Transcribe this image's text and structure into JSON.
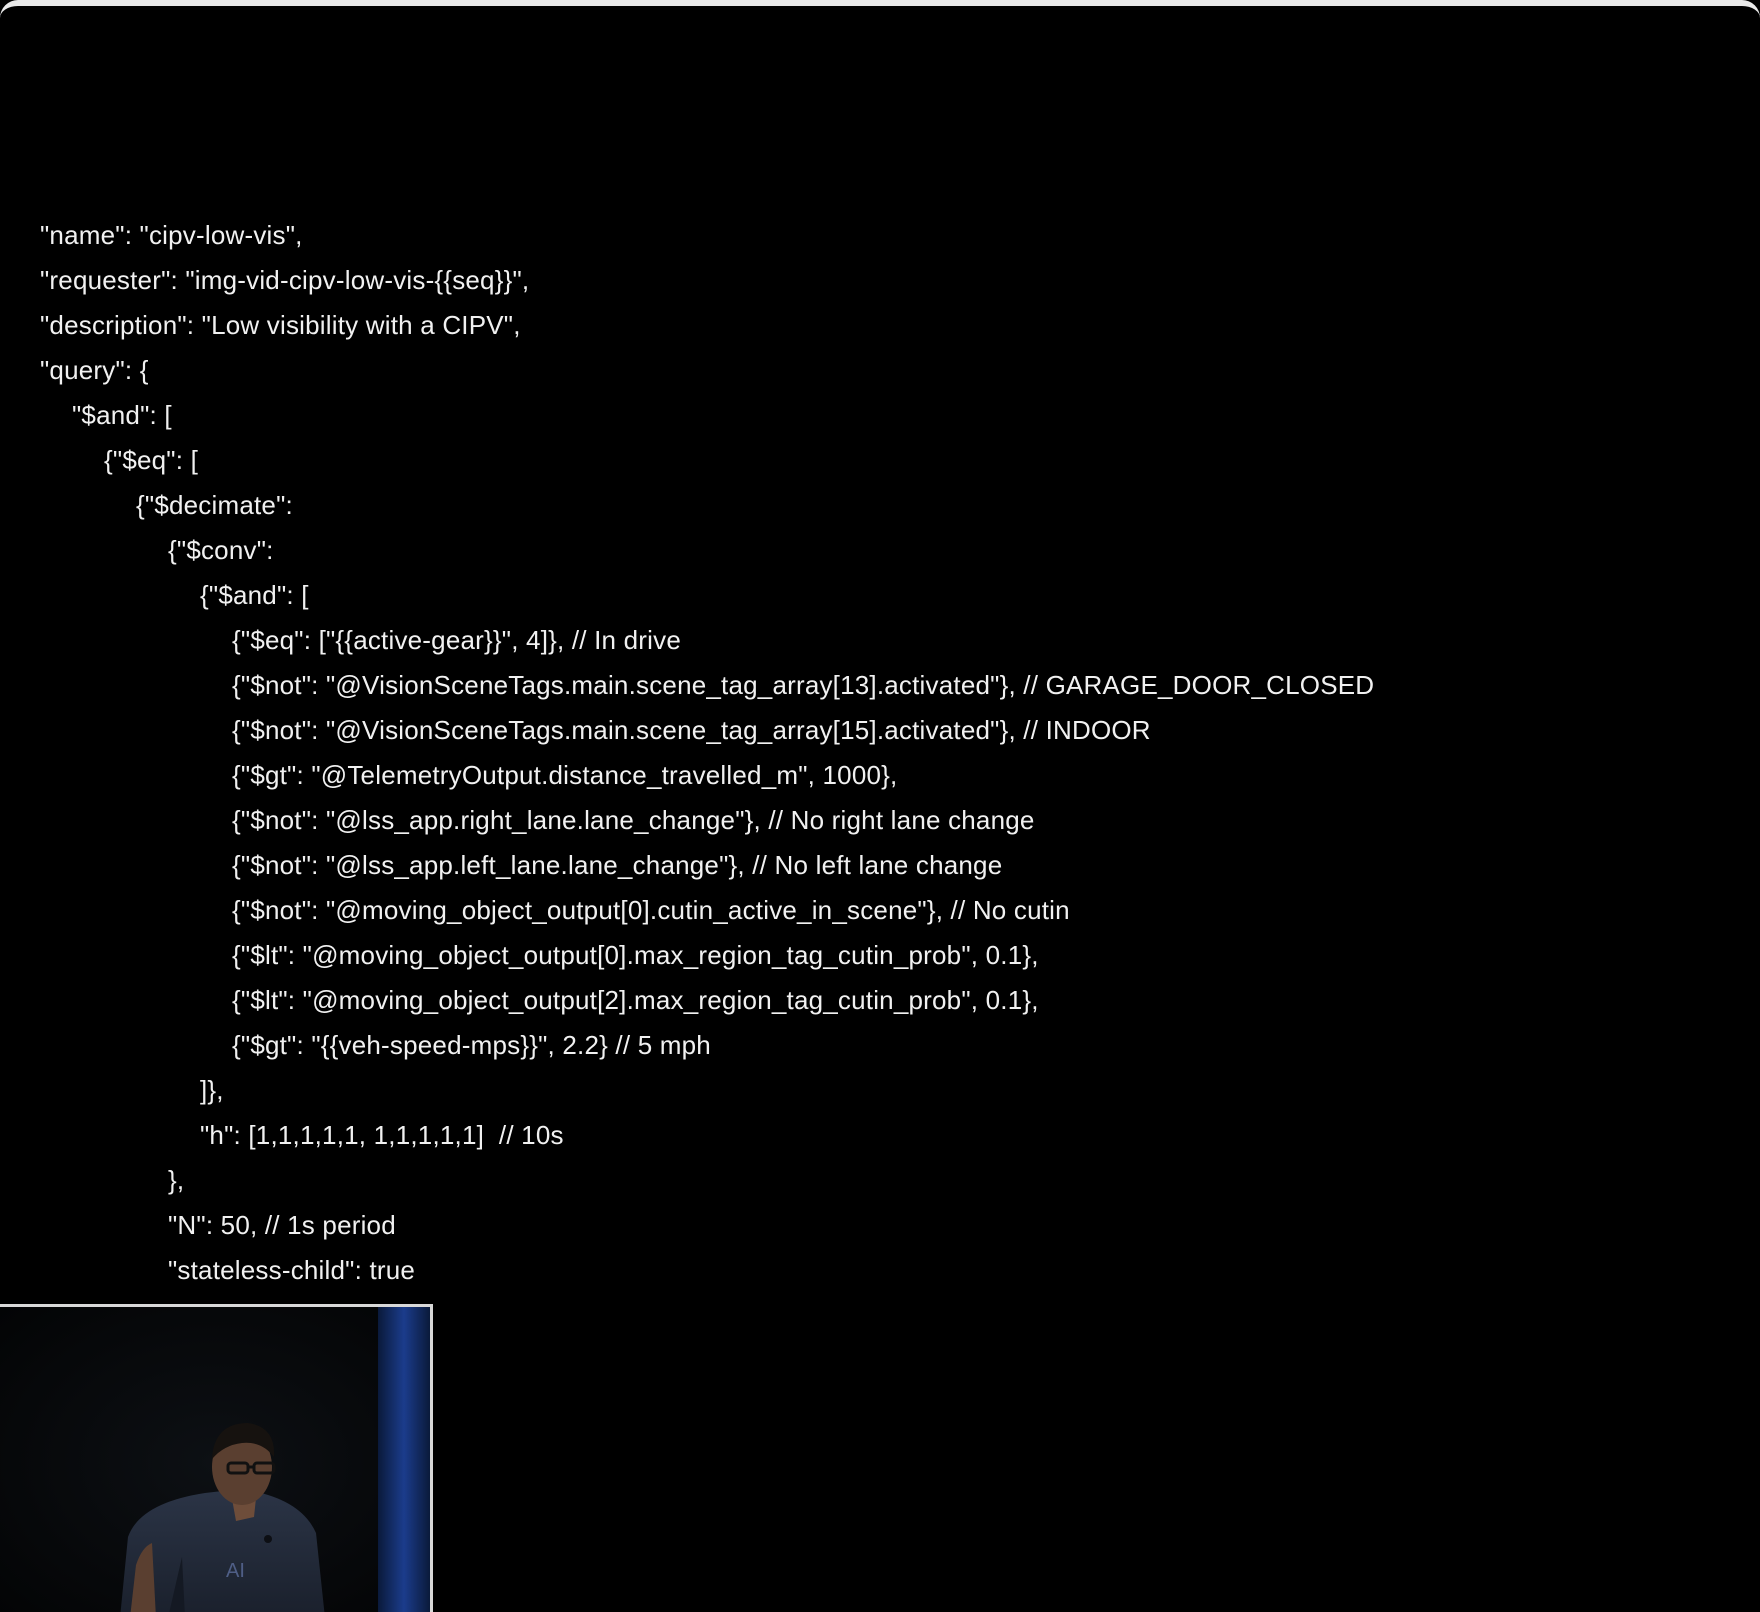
{
  "slide": {
    "code_lines": [
      {
        "indent": 0,
        "text": "\"name\": \"cipv-low-vis\","
      },
      {
        "indent": 0,
        "text": "\"requester\": \"img-vid-cipv-low-vis-{{seq}}\","
      },
      {
        "indent": 0,
        "text": "\"description\": \"Low visibility with a CIPV\","
      },
      {
        "indent": 0,
        "text": "\"query\": {"
      },
      {
        "indent": 1,
        "text": "\"$and\": ["
      },
      {
        "indent": 2,
        "text": "{\"$eq\": ["
      },
      {
        "indent": 3,
        "text": "{\"$decimate\":"
      },
      {
        "indent": 4,
        "text": "{\"$conv\":"
      },
      {
        "indent": 5,
        "text": "{\"$and\": ["
      },
      {
        "indent": 6,
        "text": "{\"$eq\": [\"{{active-gear}}\", 4]}, // In drive"
      },
      {
        "indent": 6,
        "text": "{\"$not\": \"@VisionSceneTags.main.scene_tag_array[13].activated\"}, // GARAGE_DOOR_CLOSED"
      },
      {
        "indent": 6,
        "text": "{\"$not\": \"@VisionSceneTags.main.scene_tag_array[15].activated\"}, // INDOOR"
      },
      {
        "indent": 6,
        "text": "{\"$gt\": \"@TelemetryOutput.distance_travelled_m\", 1000},"
      },
      {
        "indent": 6,
        "text": "{\"$not\": \"@lss_app.right_lane.lane_change\"}, // No right lane change"
      },
      {
        "indent": 6,
        "text": "{\"$not\": \"@lss_app.left_lane.lane_change\"}, // No left lane change"
      },
      {
        "indent": 6,
        "text": "{\"$not\": \"@moving_object_output[0].cutin_active_in_scene\"}, // No cutin"
      },
      {
        "indent": 6,
        "text": "{\"$lt\": \"@moving_object_output[0].max_region_tag_cutin_prob\", 0.1},"
      },
      {
        "indent": 6,
        "text": "{\"$lt\": \"@moving_object_output[2].max_region_tag_cutin_prob\", 0.1},"
      },
      {
        "indent": 6,
        "text": "{\"$gt\": \"{{veh-speed-mps}}\", 2.2} // 5 mph"
      },
      {
        "indent": 5,
        "text": "]},"
      },
      {
        "indent": 5,
        "text": "\"h\": [1,1,1,1,1, 1,1,1,1,1]  // 10s"
      },
      {
        "indent": 4,
        "text": "},"
      },
      {
        "indent": 4,
        "text": "\"N\": 50, // 1s period"
      },
      {
        "indent": 4,
        "text": "\"stateless-child\": true"
      }
    ]
  },
  "speaker_video": {
    "shirt_print": "AI"
  }
}
